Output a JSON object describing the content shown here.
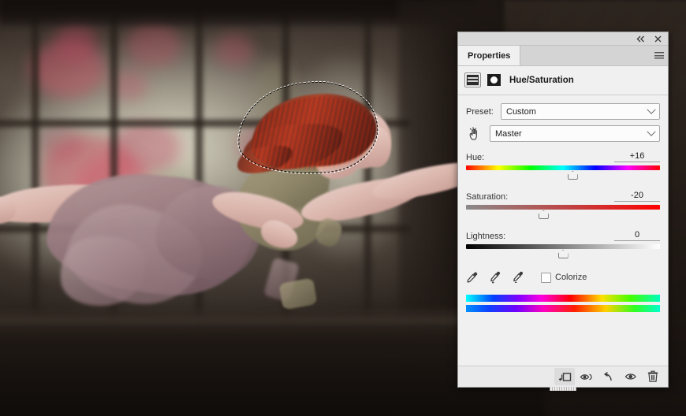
{
  "panel": {
    "tab_label": "Properties",
    "collapse_icon": "double-chevron-left-icon",
    "close_icon": "close-icon",
    "menu_icon": "panel-menu-icon",
    "adjustment_title": "Hue/Saturation",
    "adjustment_icon": "hue-saturation-adjustment-icon",
    "mask_icon": "layer-mask-icon",
    "preset": {
      "label": "Preset:",
      "value": "Custom"
    },
    "channel": {
      "hand_icon": "on-image-adjust-hand-icon",
      "value": "Master"
    },
    "sliders": [
      {
        "label": "Hue:",
        "value": "+16",
        "percent": 55,
        "track": "hue"
      },
      {
        "label": "Saturation:",
        "value": "-20",
        "percent": 40,
        "track": "sat"
      },
      {
        "label": "Lightness:",
        "value": "0",
        "percent": 50,
        "track": "light"
      }
    ],
    "eyedroppers": [
      "eyedropper-icon",
      "eyedropper-add-icon",
      "eyedropper-subtract-icon"
    ],
    "colorize": {
      "label": "Colorize",
      "checked": false
    },
    "footer_buttons": [
      "clip-to-layer-icon",
      "view-previous-state-icon",
      "reset-icon",
      "toggle-layer-visibility-icon",
      "delete-adjustment-layer-icon"
    ]
  },
  "canvas": {
    "description": "Photoshop document canvas showing a woman in a flowing dress floating horizontally in front of a blurred window with pink flowers, red hair with an active marching-ants selection",
    "selection_label": "marching-ants-selection-around-hair"
  },
  "colors": {
    "panel_background": "#f0f0f0",
    "panel_border": "#9a9a9a",
    "tab_background": "#d4d4d4",
    "text": "#2e2e2e",
    "hair": "#a8432b",
    "dress": "#96787e",
    "wall": "#3a302a",
    "window_light": "#e2e0cc"
  }
}
